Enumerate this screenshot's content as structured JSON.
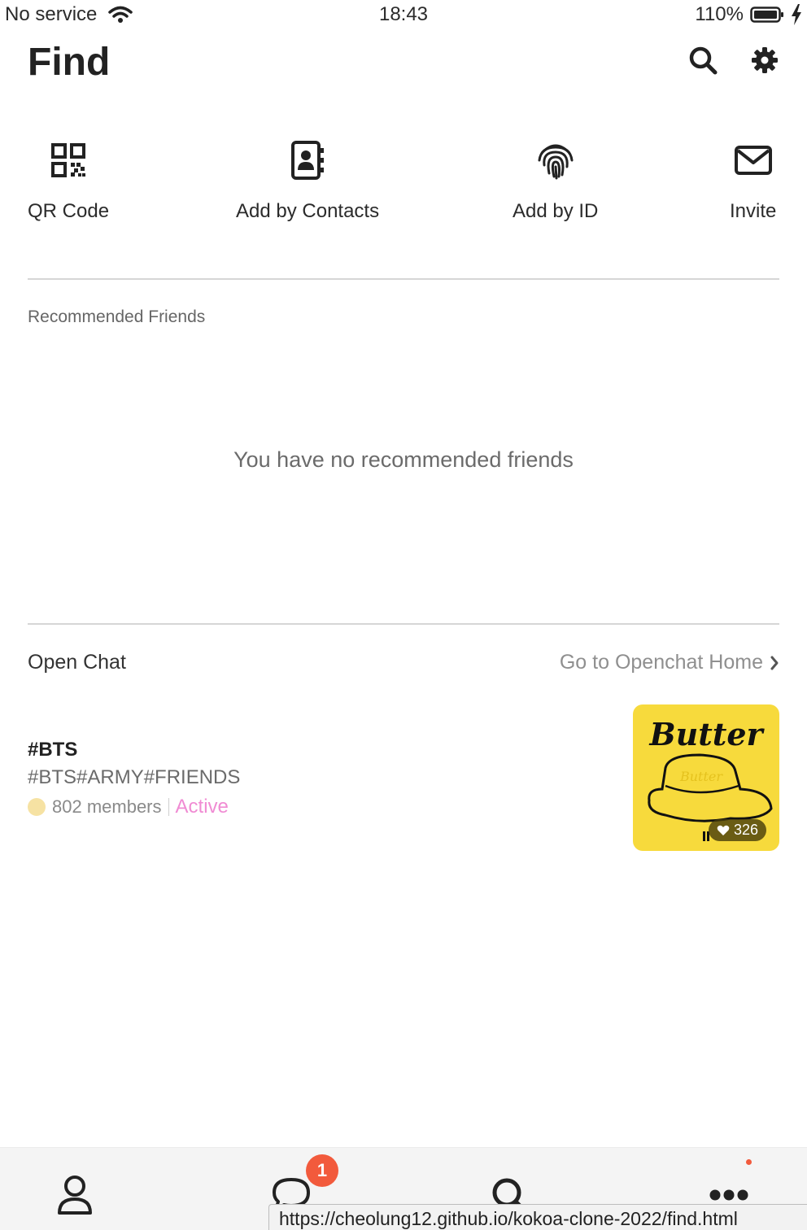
{
  "status_bar": {
    "carrier": "No service",
    "time": "18:43",
    "battery_percent": "110%"
  },
  "header": {
    "title": "Find",
    "actions": [
      "search-icon",
      "gear-icon"
    ]
  },
  "find_options": [
    {
      "label": "QR Code",
      "icon": "qr-code-icon"
    },
    {
      "label": "Add by Contacts",
      "icon": "address-book-icon"
    },
    {
      "label": "Add by ID",
      "icon": "fingerprint-icon"
    },
    {
      "label": "Invite",
      "icon": "envelope-icon"
    }
  ],
  "recommended": {
    "title": "Recommended Friends",
    "empty_message": "You have no recommended friends"
  },
  "open_chat": {
    "title": "Open Chat",
    "home_link": "Go to Openchat Home",
    "items": [
      {
        "name": "#BTS",
        "tags": "#BTS#ARMY#FRIENDS",
        "members": "802 members",
        "status": "Active",
        "thumbnail_title": "Butter",
        "likes": "326"
      }
    ]
  },
  "tab_bar": {
    "tabs": [
      "user-icon",
      "chat-bubble-icon",
      "search-icon",
      "more-icon"
    ],
    "chat_badge": "1"
  },
  "url_tooltip": "https://cheolung12.github.io/kokoa-clone-2022/find.html",
  "colors": {
    "active_status": "#f08bd3",
    "badge": "#f25a3c",
    "thumbnail_bg": "#f7da3c"
  }
}
